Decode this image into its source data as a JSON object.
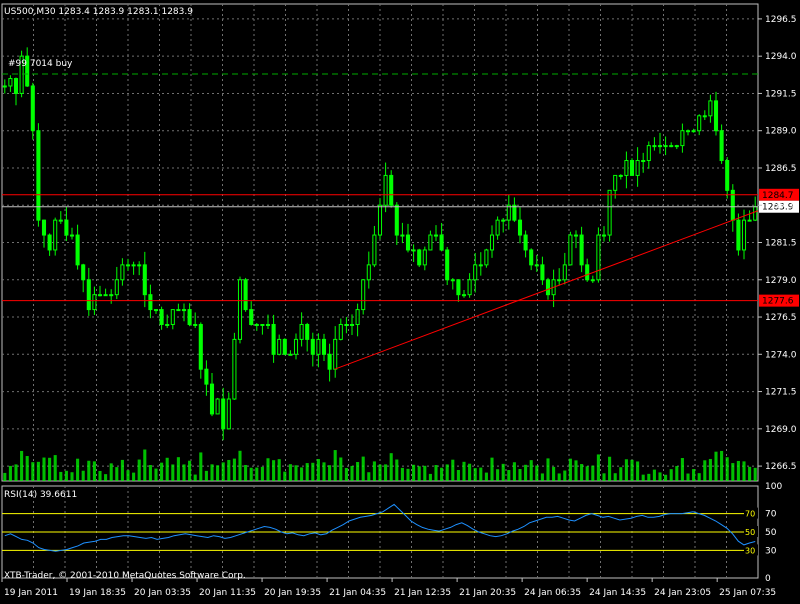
{
  "chart_data": [
    {
      "type": "candlestick",
      "header": "US500,M30  1283.4 1283.9 1283.1 1283.9",
      "order_label": "#99 7014 buy",
      "price_axis": {
        "ticks": [
          "1296.5",
          "1294.0",
          "1291.5",
          "1289.0",
          "1286.5",
          "1284.0",
          "1281.5",
          "1279.0",
          "1276.5",
          "1274.0",
          "1271.5",
          "1269.0",
          "1266.5"
        ],
        "tick_values": [
          1296.5,
          1294.0,
          1291.5,
          1289.0,
          1286.5,
          1284.0,
          1281.5,
          1279.0,
          1276.5,
          1274.0,
          1271.5,
          1269.0,
          1266.5
        ],
        "ylim": [
          1265.5,
          1297.5
        ]
      },
      "current_price_label": "1283.9",
      "current_price": 1283.9,
      "level_labels": [
        "1284.7",
        "1277.6"
      ],
      "levels": [
        1284.7,
        1277.6
      ],
      "order_level": 1292.8,
      "trendline": [
        [
          0.44,
          1273.0
        ],
        [
          0.93,
          1282.3
        ]
      ],
      "grid": true,
      "colors": {
        "bull": "#00ff00",
        "grid": "#c0c0c0",
        "level": "#ff0000",
        "order": "#00aa00",
        "bg": "#000000",
        "volume": "#00ff00"
      },
      "close_series": [
        1292,
        1292.5,
        1291.5,
        1294,
        1292,
        1289,
        1283,
        1282,
        1281,
        1283,
        1283,
        1282,
        1282,
        1280,
        1279,
        1277,
        1278,
        1278,
        1278,
        1278,
        1279,
        1280,
        1280,
        1280,
        1280,
        1278,
        1277,
        1277,
        1276,
        1276,
        1277,
        1277,
        1277,
        1276,
        1276,
        1273,
        1272,
        1270,
        1271,
        1269,
        1271,
        1275,
        1279,
        1277,
        1276,
        1276,
        1276,
        1276,
        1274,
        1275,
        1274,
        1274,
        1275,
        1276,
        1275,
        1274,
        1275,
        1274,
        1273,
        1275,
        1276,
        1276,
        1276,
        1277,
        1279,
        1280,
        1282,
        1284,
        1286,
        1284,
        1282,
        1282,
        1281,
        1281,
        1280,
        1281,
        1282,
        1282,
        1281,
        1279,
        1279,
        1278,
        1278,
        1279,
        1280,
        1280,
        1281,
        1282,
        1283,
        1283,
        1284,
        1283,
        1282,
        1281,
        1280,
        1280,
        1279,
        1278,
        1279,
        1279,
        1280,
        1282,
        1282,
        1280,
        1279,
        1279,
        1282,
        1282,
        1285,
        1286,
        1286,
        1287,
        1286,
        1287,
        1287,
        1288,
        1288,
        1288,
        1288,
        1288,
        1288,
        1289,
        1289,
        1289,
        1290,
        1290,
        1291,
        1289,
        1287,
        1285,
        1283,
        1281,
        1283,
        1283,
        1283.9
      ],
      "volume_label": "",
      "indicator": {
        "label": "RSI(14) 39.6611",
        "axis_ticks": [
          "100",
          "70",
          "50",
          "30",
          "0"
        ],
        "axis_values": [
          100,
          70,
          50,
          30,
          0
        ],
        "levels": [
          70,
          50,
          30
        ],
        "level_labels": [
          "70",
          "50",
          "30"
        ],
        "color": "#1e90ff",
        "level_color": "#ffff00",
        "values": [
          46,
          48,
          45,
          42,
          41,
          38,
          33,
          31,
          30,
          29,
          30,
          31,
          33,
          35,
          38,
          39,
          40,
          42,
          42,
          44,
          45,
          46,
          46,
          45,
          44,
          43,
          44,
          42,
          43,
          44,
          46,
          47,
          48,
          47,
          46,
          45,
          44,
          46,
          45,
          43,
          44,
          46,
          48,
          50,
          52,
          54,
          56,
          55,
          53,
          50,
          48,
          49,
          47,
          46,
          48,
          49,
          47,
          48,
          52,
          55,
          58,
          62,
          64,
          66,
          67,
          68,
          70,
          72,
          76,
          80,
          74,
          68,
          62,
          58,
          55,
          53,
          52,
          51,
          53,
          55,
          58,
          60,
          57,
          53,
          50,
          48,
          46,
          45,
          46,
          48,
          51,
          53,
          56,
          60,
          62,
          64,
          66,
          66,
          67,
          65,
          63,
          62,
          65,
          68,
          70,
          68,
          66,
          67,
          65,
          63,
          64,
          65,
          67,
          68,
          66,
          66,
          67,
          69,
          70,
          70,
          70,
          71,
          72,
          70,
          68,
          65,
          62,
          58,
          54,
          48,
          40,
          36,
          38,
          39.66
        ]
      },
      "x_axis": {
        "ticks": [
          "19 Jan 2011",
          "19 Jan 18:35",
          "20 Jan 03:35",
          "20 Jan 11:35",
          "20 Jan 19:35",
          "21 Jan 04:35",
          "21 Jan 12:35",
          "21 Jan 20:35",
          "24 Jan 06:35",
          "24 Jan 14:35",
          "24 Jan 23:05",
          "25 Jan 07:35"
        ],
        "tick_positions": [
          0.0,
          0.086,
          0.172,
          0.258,
          0.344,
          0.43,
          0.516,
          0.602,
          0.688,
          0.774,
          0.86,
          0.946
        ]
      },
      "copyright": "XTB-Trader, © 2001-2010 MetaQuotes Software Corp."
    }
  ]
}
